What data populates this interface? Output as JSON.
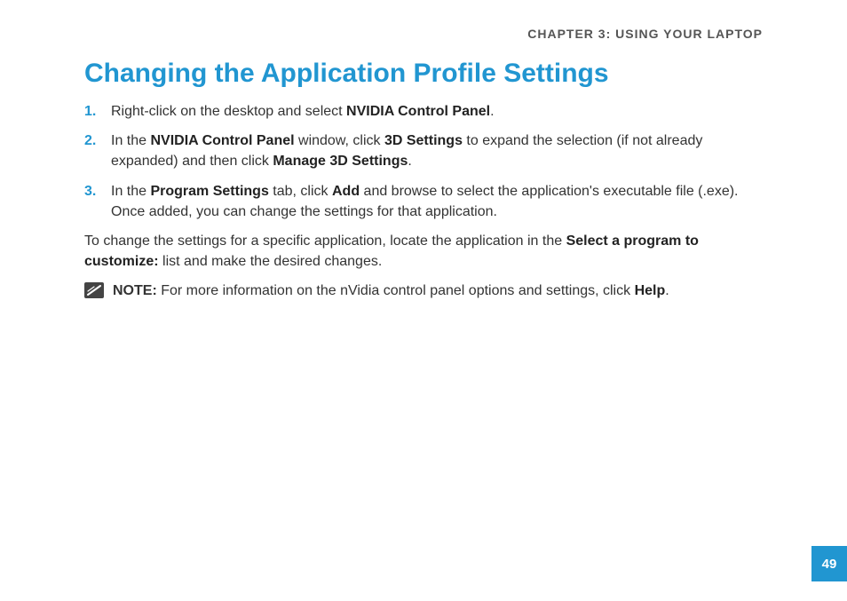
{
  "chapterHeader": "CHAPTER 3: USING YOUR LAPTOP",
  "title": "Changing the Application Profile Settings",
  "steps": [
    {
      "num": "1.",
      "leading": "Right-click on the desktop and select ",
      "bold1": "NVIDIA Control Panel",
      "tail": "."
    },
    {
      "num": "2.",
      "leading": "In the ",
      "bold1": "NVIDIA Control Panel",
      "mid1": " window, click ",
      "bold2": "3D Settings",
      "mid2": " to expand the selection (if not already expanded) and then click ",
      "bold3": "Manage 3D Settings",
      "tail": "."
    },
    {
      "num": "3.",
      "leading": "In the ",
      "bold1": "Program Settings",
      "mid1": " tab, click ",
      "bold2": "Add",
      "tail": " and browse to select the application's executable file (.exe). Once added, you can change the settings for that application."
    }
  ],
  "paragraph": {
    "leading": "To change the settings for a specific application, locate the application in the ",
    "bold1": "Select a program to customize:",
    "tail": " list and make the desired changes."
  },
  "note": {
    "label": "NOTE:",
    "leading": " For more information on the nVidia control panel options and settings, click  ",
    "bold1": "Help",
    "tail": "."
  },
  "pageNumber": "49"
}
